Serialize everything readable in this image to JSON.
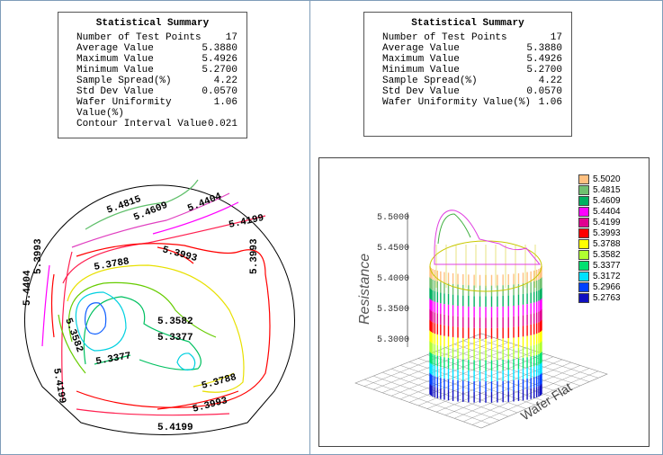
{
  "summaries": [
    {
      "title": "Statistical Summary",
      "rows": [
        {
          "label": "Number of Test Points",
          "value": "17"
        },
        {
          "label": "Average Value",
          "value": "5.3880"
        },
        {
          "label": "Maximum Value",
          "value": "5.4926"
        },
        {
          "label": "Minimum Value",
          "value": "5.2700"
        },
        {
          "label": "Sample Spread(%)",
          "value": "4.22"
        },
        {
          "label": "Std Dev Value",
          "value": "0.0570"
        },
        {
          "label": "Wafer Uniformity Value(%)",
          "value": "1.06"
        },
        {
          "label": "Contour Interval Value",
          "value": "0.021"
        }
      ]
    },
    {
      "title": "Statistical Summary",
      "rows": [
        {
          "label": "Number of Test Points",
          "value": "17"
        },
        {
          "label": "Average Value",
          "value": "5.3880"
        },
        {
          "label": "Maximum Value",
          "value": "5.4926"
        },
        {
          "label": "Minimum Value",
          "value": "5.2700"
        },
        {
          "label": "Sample Spread(%)",
          "value": "4.22"
        },
        {
          "label": "Std Dev Value",
          "value": "0.0570"
        },
        {
          "label": "Wafer Uniformity Value(%)",
          "value": "1.06"
        }
      ]
    }
  ],
  "chart_data": [
    {
      "type": "contour",
      "contour_levels": [
        "5.4815",
        "5.4609",
        "5.4404",
        "5.4199",
        "5.3993",
        "5.3788",
        "5.3582",
        "5.3377"
      ],
      "level_colors": {
        "5.4815": "#5fbf6a",
        "5.4609": "#e040c0",
        "5.4404": "#ff00ff",
        "5.4199": "#ff2050",
        "5.3993": "#ff0000",
        "5.3788": "#e8e000",
        "5.3582": "#66cc00",
        "5.3377": "#00c060",
        "5.3172": "#00d0e0",
        "5.2966": "#1060ff"
      }
    },
    {
      "type": "surface3d",
      "ylabel": "Resistance",
      "xlabel": "Wafer Flat",
      "z_ticks": [
        "5.5000",
        "5.4500",
        "5.4000",
        "5.3500",
        "5.3000"
      ],
      "legend": [
        {
          "label": "5.5020",
          "color": "#ffc080"
        },
        {
          "label": "5.4815",
          "color": "#70c070"
        },
        {
          "label": "5.4609",
          "color": "#00b060"
        },
        {
          "label": "5.4404",
          "color": "#ff00ff"
        },
        {
          "label": "5.4199",
          "color": "#e00090"
        },
        {
          "label": "5.3993",
          "color": "#ff0000"
        },
        {
          "label": "5.3788",
          "color": "#ffff00"
        },
        {
          "label": "5.3582",
          "color": "#b0ff30"
        },
        {
          "label": "5.3377",
          "color": "#00e070"
        },
        {
          "label": "5.3172",
          "color": "#00e0ff"
        },
        {
          "label": "5.2966",
          "color": "#0040ff"
        },
        {
          "label": "5.2763",
          "color": "#1010c0"
        }
      ]
    }
  ]
}
